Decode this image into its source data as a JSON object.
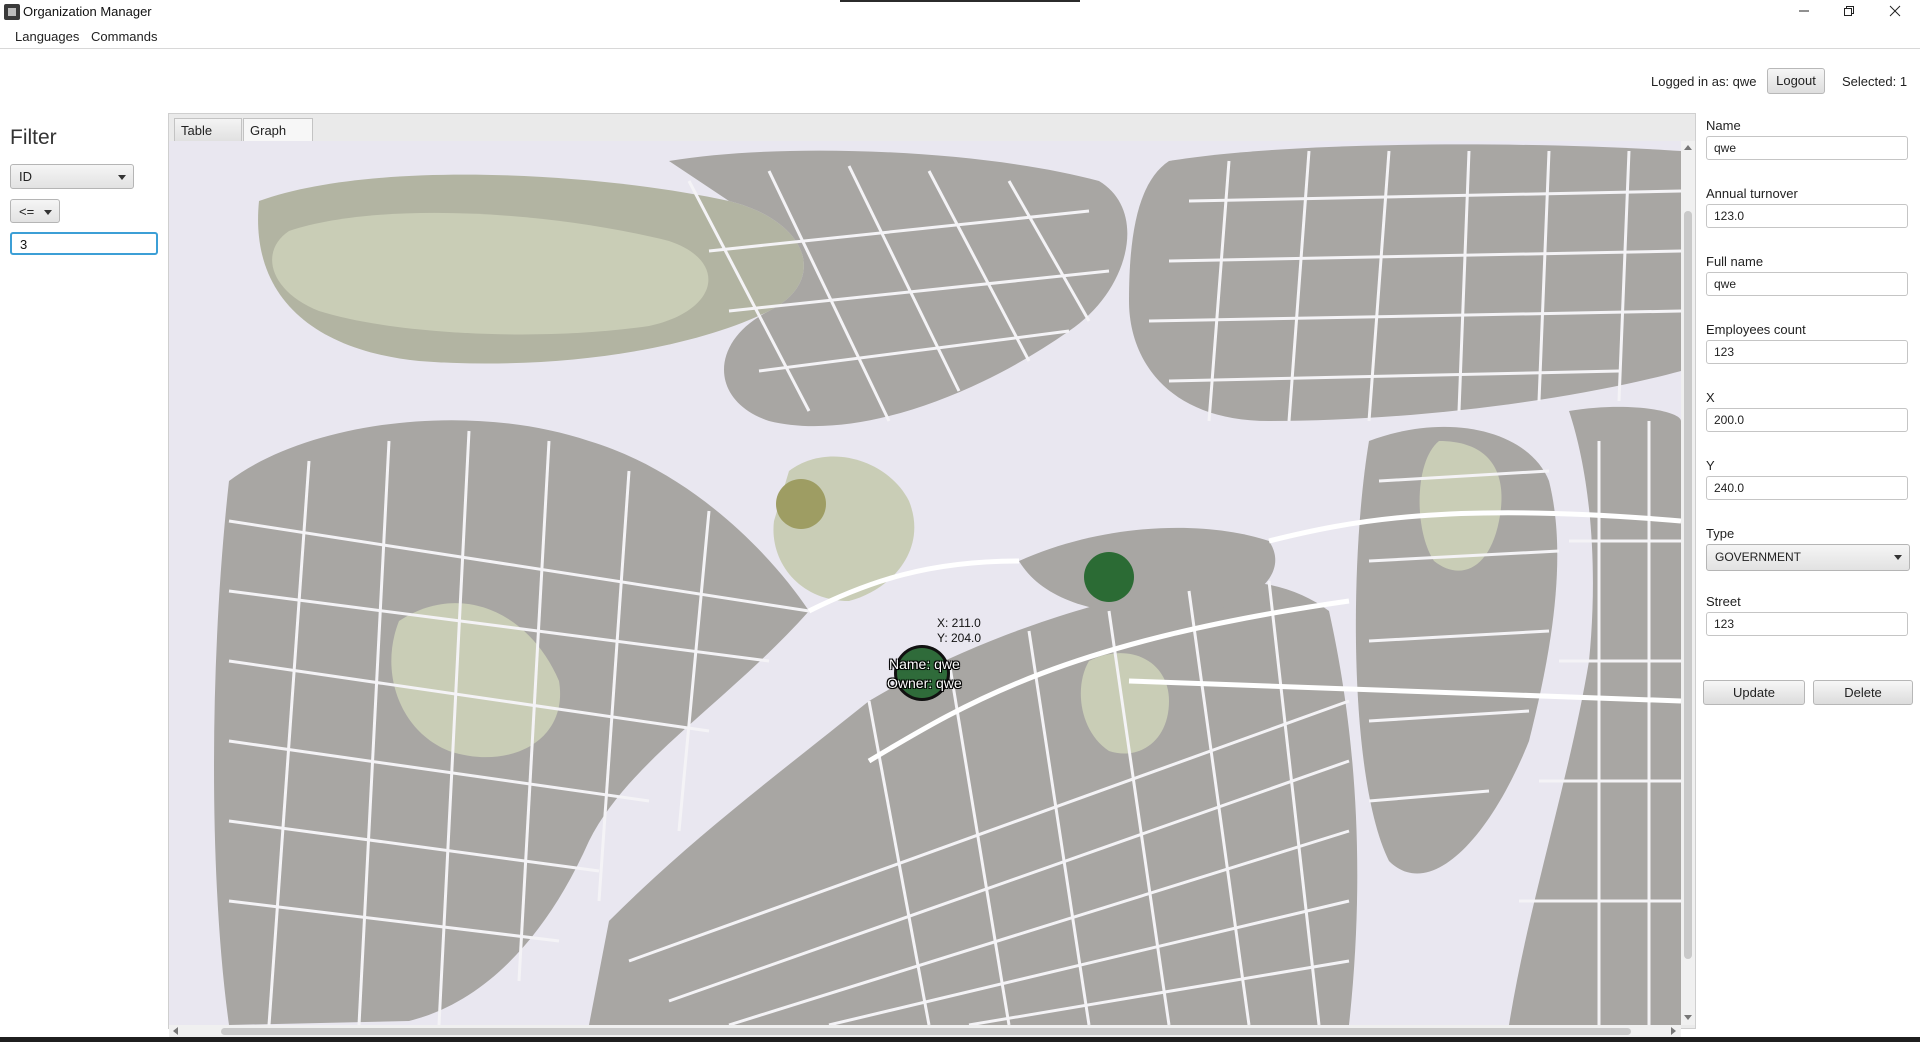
{
  "window": {
    "title": "Organization Manager"
  },
  "menu": {
    "items": [
      "Languages",
      "Commands"
    ]
  },
  "status": {
    "logged_in": "Logged in as: qwe",
    "logout_label": "Logout",
    "selected": "Selected: 1"
  },
  "filter": {
    "title": "Filter",
    "field": "ID",
    "operator": "<=",
    "value": "3"
  },
  "tabs": [
    "Table view",
    "Graph view"
  ],
  "graph": {
    "markers": [
      {
        "color": "#9e9d63"
      },
      {
        "color": "#2b6b34"
      },
      {
        "color": "#2f6b3a",
        "name_label": "Name: qwe",
        "owner_label": "Owner: qwe",
        "x_label": "X: 211.0",
        "y_label": "Y: 204.0"
      }
    ]
  },
  "form": {
    "name_label": "Name",
    "name_value": "qwe",
    "turnover_label": "Annual turnover",
    "turnover_value": "123.0",
    "fullname_label": "Full name",
    "fullname_value": "qwe",
    "employees_label": "Employees count",
    "employees_value": "123",
    "x_label": "X",
    "x_value": "200.0",
    "y_label": "Y",
    "y_value": "240.0",
    "type_label": "Type",
    "type_value": "GOVERNMENT",
    "street_label": "Street",
    "street_value": "123",
    "update_label": "Update",
    "delete_label": "Delete"
  }
}
